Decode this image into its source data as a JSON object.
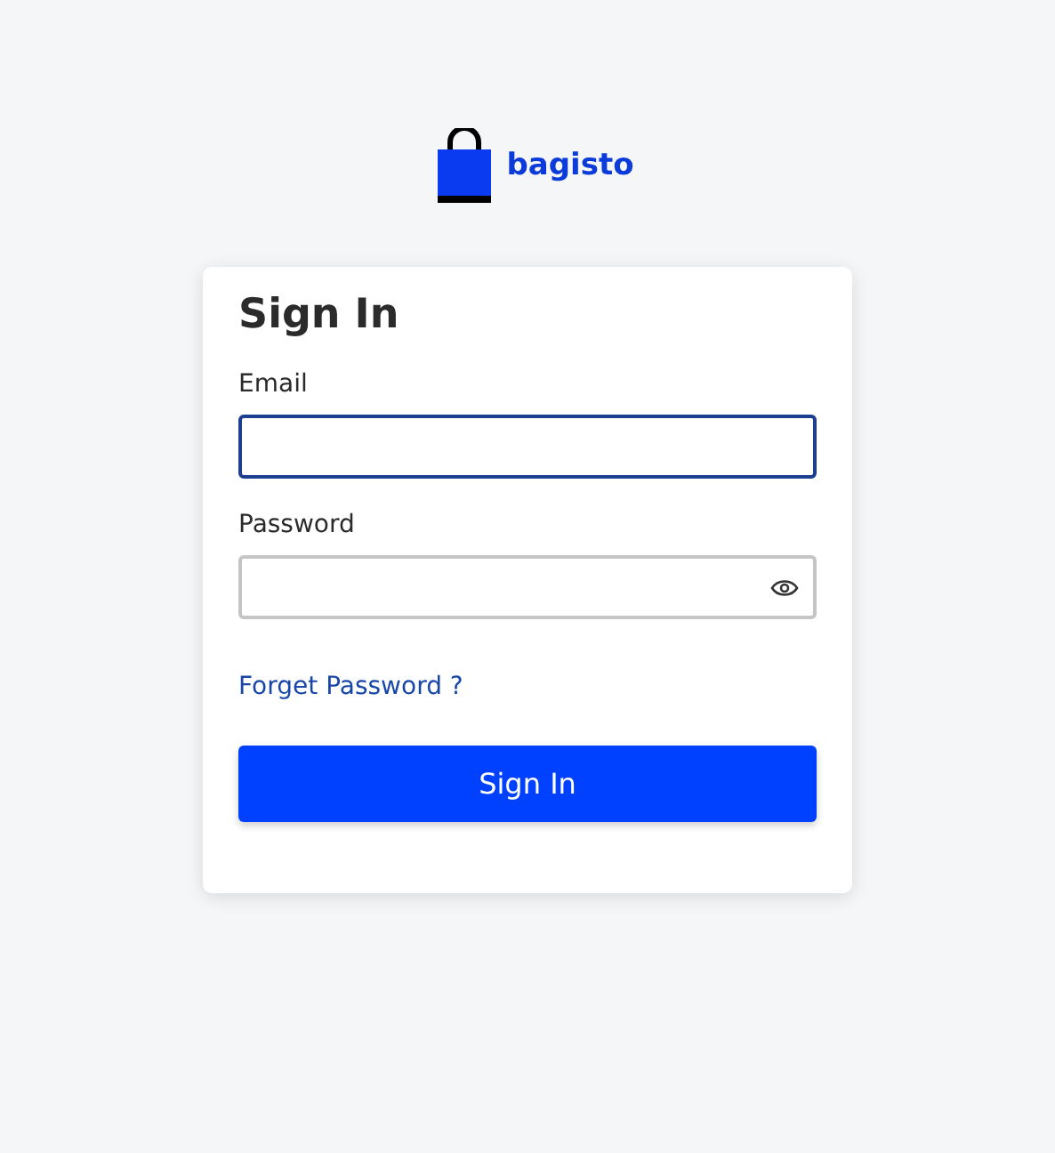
{
  "brand": {
    "name": "bagisto"
  },
  "form": {
    "title": "Sign In",
    "fields": [
      {
        "label": "Email",
        "kind": "email",
        "focused": true
      },
      {
        "label": "Password",
        "kind": "password",
        "focused": false
      }
    ],
    "forgot_link": "Forget Password ?",
    "submit": "Sign In"
  }
}
